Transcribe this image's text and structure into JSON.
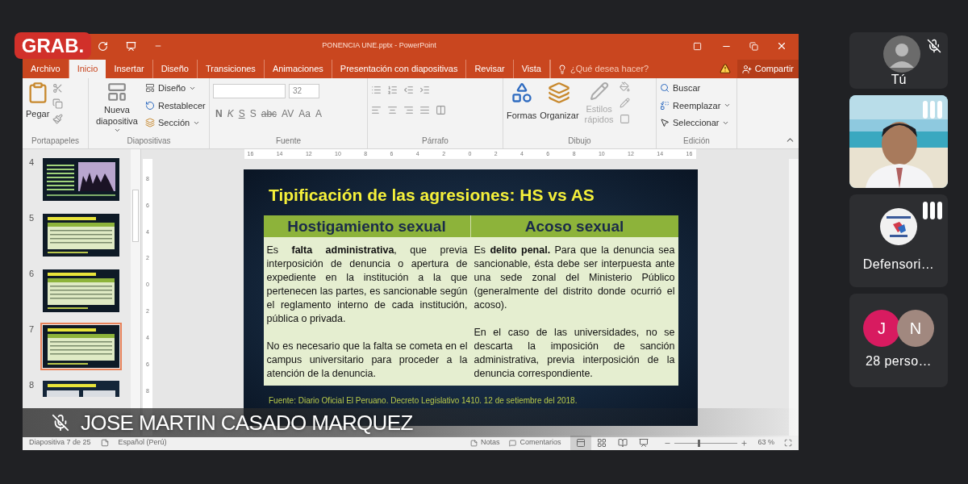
{
  "recording_badge": "GRAB.",
  "window": {
    "title": "PONENCIA UNE.pptx - PowerPoint"
  },
  "tabs": [
    {
      "label": "Archivo",
      "selected": false
    },
    {
      "label": "Inicio",
      "selected": true
    },
    {
      "label": "Insertar",
      "selected": false
    },
    {
      "label": "Diseño",
      "selected": false
    },
    {
      "label": "Transiciones",
      "selected": false
    },
    {
      "label": "Animaciones",
      "selected": false
    },
    {
      "label": "Presentación con diapositivas",
      "selected": false
    },
    {
      "label": "Revisar",
      "selected": false
    },
    {
      "label": "Vista",
      "selected": false
    }
  ],
  "tell_me": "¿Qué desea hacer?",
  "share": "Compartir",
  "ribbon": {
    "clipboard": {
      "paste": "Pegar",
      "label": "Portapapeles"
    },
    "slides": {
      "new_slide": "Nueva diapositiva",
      "layout": "Diseño",
      "reset": "Restablecer",
      "section": "Sección",
      "label": "Diapositivas"
    },
    "font": {
      "size": "32",
      "buttons": [
        {
          "label": "N",
          "kind": "bold"
        },
        {
          "label": "K",
          "kind": "italic"
        },
        {
          "label": "S",
          "kind": "underline"
        },
        {
          "label": "S",
          "kind": "shadow"
        },
        {
          "label": "abc",
          "kind": "strike"
        },
        {
          "label": "AV",
          "kind": "spacing"
        },
        {
          "label": "Aa",
          "kind": "case"
        },
        {
          "label": "A",
          "kind": "color"
        }
      ],
      "label": "Fuente"
    },
    "paragraph": {
      "label": "Párrafo"
    },
    "drawing": {
      "shapes": "Formas",
      "arrange": "Organizar",
      "quick_styles": {
        "label": "Estilos rápidos",
        "disabled": true
      },
      "label": "Dibujo"
    },
    "editing": {
      "find": "Buscar",
      "replace": "Reemplazar",
      "select": "Seleccionar",
      "label": "Edición"
    }
  },
  "ruler_marks": [
    "16",
    "14",
    "12",
    "10",
    "8",
    "6",
    "4",
    "2",
    "0",
    "2",
    "4",
    "6",
    "8",
    "10",
    "12",
    "14",
    "16"
  ],
  "vertical_ruler_marks": [
    "8",
    "6",
    "4",
    "2",
    "0",
    "2",
    "4",
    "6",
    "8"
  ],
  "thumbnails": [
    {
      "number": "4",
      "selected": false
    },
    {
      "number": "5",
      "selected": false,
      "kind": "table"
    },
    {
      "number": "6",
      "selected": false,
      "kind": "table"
    },
    {
      "number": "7",
      "selected": true,
      "kind": "table"
    },
    {
      "number": "8",
      "selected": false,
      "kind": "document"
    }
  ],
  "slide": {
    "title": "Tipificación de las agresiones: HS vs AS",
    "columns": [
      {
        "heading": "Hostigamiento sexual",
        "paragraphs": [
          "Es **falta administrativa**, que previa interposición de denuncia o apertura de expediente en la institución a la que pertenecen las partes, es sancionable según el reglamento interno de cada institución, pública o privada.",
          "No es necesario que la falta se cometa en el campus universitario para proceder a la atención de la denuncia."
        ]
      },
      {
        "heading": "Acoso sexual",
        "paragraphs": [
          "Es **delito penal.** Para que la denuncia sea sancionable, ésta debe ser interpuesta ante una sede zonal del Ministerio Público (generalmente del distrito donde ocurrió el acoso).",
          "En el caso de las universidades, no se descarta la imposición de sanción administrativa, previa interposición de la denuncia correspondiente."
        ]
      }
    ],
    "source": "Fuente: Diario Oficial El Peruano. Decreto Legislativo 1410. 12 de setiembre del 2018."
  },
  "speaker": {
    "name": "JOSE MARTIN CASADO MARQUEZ",
    "muted": true
  },
  "status_bar": {
    "slide_info": "Diapositiva 7 de 25",
    "language": "Español (Perú)",
    "notes": "Notas",
    "comments": "Comentarios",
    "views": [
      {
        "kind": "normal",
        "selected": true
      },
      {
        "kind": "sorter",
        "selected": false
      },
      {
        "kind": "reading",
        "selected": false
      },
      {
        "kind": "slideshow",
        "selected": false
      }
    ],
    "zoom_slider": {
      "level": 0.36
    },
    "zoom": "63 %"
  },
  "participants": [
    {
      "kind": "self",
      "name": "Tú",
      "muted": true
    },
    {
      "kind": "video",
      "speaking": true
    },
    {
      "kind": "logo",
      "name": "Defensori…",
      "speaking": true
    },
    {
      "kind": "group",
      "name": "28 perso…",
      "avatars": [
        {
          "initial": "J",
          "color": "#d81b60"
        },
        {
          "initial": "N",
          "color": "#a1887f"
        }
      ]
    }
  ]
}
